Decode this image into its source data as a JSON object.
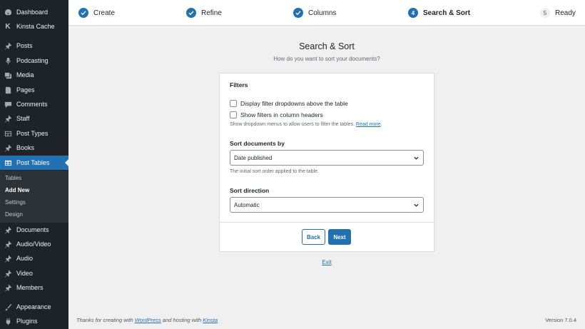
{
  "sidebar": {
    "items": [
      {
        "label": "Dashboard",
        "icon": "dashboard-icon"
      },
      {
        "label": "Kinsta Cache",
        "icon": "kinsta-icon"
      },
      {
        "label": "Posts",
        "icon": "pin-icon"
      },
      {
        "label": "Podcasting",
        "icon": "microphone-icon"
      },
      {
        "label": "Media",
        "icon": "media-icon"
      },
      {
        "label": "Pages",
        "icon": "page-icon"
      },
      {
        "label": "Comments",
        "icon": "comment-icon"
      },
      {
        "label": "Staff",
        "icon": "pin-icon"
      },
      {
        "label": "Post Types",
        "icon": "post-types-icon"
      },
      {
        "label": "Books",
        "icon": "pin-icon"
      },
      {
        "label": "Post Tables",
        "icon": "table-icon"
      },
      {
        "label": "Documents",
        "icon": "pin-icon"
      },
      {
        "label": "Audio/Video",
        "icon": "pin-icon"
      },
      {
        "label": "Audio",
        "icon": "pin-icon"
      },
      {
        "label": "Video",
        "icon": "pin-icon"
      },
      {
        "label": "Members",
        "icon": "pin-icon"
      },
      {
        "label": "Appearance",
        "icon": "brush-icon"
      },
      {
        "label": "Plugins",
        "icon": "plugin-icon"
      }
    ],
    "submenu": [
      "Tables",
      "Add New",
      "Settings",
      "Design"
    ]
  },
  "stepper": {
    "steps": [
      {
        "label": "Create",
        "state": "done"
      },
      {
        "label": "Refine",
        "state": "done"
      },
      {
        "label": "Columns",
        "state": "done"
      },
      {
        "label": "Search & Sort",
        "state": "current",
        "number": "4"
      },
      {
        "label": "Ready",
        "state": "pending",
        "number": "5"
      }
    ]
  },
  "main": {
    "title": "Search & Sort",
    "subtitle": "How do you want to sort your documents?",
    "filters_label": "Filters",
    "checkbox1": "Display filter dropdowns above the table",
    "checkbox2": "Show filters in column headers",
    "filters_help": "Show dropdown menus to allow users to filter the tables.",
    "read_more": "Read more",
    "sort_label": "Sort documents by",
    "sort_value": "Date published",
    "sort_help": "The initial sort order applied to the table.",
    "direction_label": "Sort direction",
    "direction_value": "Automatic",
    "back": "Back",
    "next": "Next",
    "exit": "Exit"
  },
  "footer": {
    "thanks_pre": "Thanks for creating with",
    "wordpress": "WordPress",
    "thanks_mid": "and hosting with",
    "kinsta": "Kinsta",
    "version": "Version 7.0.4"
  },
  "colors": {
    "accent": "#2271b1",
    "sidebar": "#1d2327"
  }
}
